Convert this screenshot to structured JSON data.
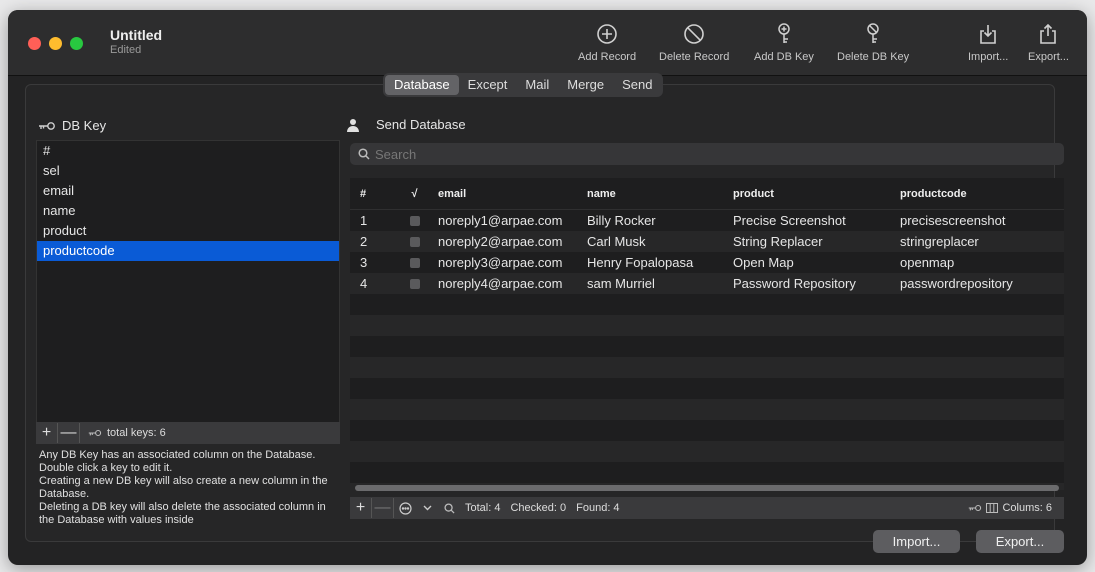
{
  "window": {
    "title": "Untitled",
    "subtitle": "Edited"
  },
  "toolbar": {
    "add_record": "Add Record",
    "delete_record": "Delete Record",
    "add_db_key": "Add DB Key",
    "delete_db_key": "Delete DB Key",
    "import": "Import...",
    "export": "Export..."
  },
  "tabs": [
    "Database",
    "Except",
    "Mail",
    "Merge",
    "Send"
  ],
  "active_tab": "Database",
  "left": {
    "header": "DB Key",
    "keys": [
      "#",
      "sel",
      "email",
      "name",
      "product",
      "productcode"
    ],
    "selected_key": "productcode",
    "footer_add": "+",
    "footer_remove": "—",
    "total_keys": "total keys: 6",
    "help": [
      "Any DB Key has an associated column on the Database. Double click a key to edit it.",
      "Creating a new DB key will also create a new column in the Database.",
      "Deleting a DB key will also delete the associated column in the Database with values inside"
    ]
  },
  "right": {
    "header": "Send Database",
    "search_placeholder": "Search",
    "columns": [
      "#",
      "√",
      "email",
      "name",
      "product",
      "productcode"
    ],
    "rows": [
      {
        "num": "1",
        "email": "noreply1@arpae.com",
        "name": "Billy Rocker",
        "product": "Precise Screenshot",
        "productcode": "precisescreenshot"
      },
      {
        "num": "2",
        "email": "noreply2@arpae.com",
        "name": "Carl Musk",
        "product": "String Replacer",
        "productcode": "stringreplacer"
      },
      {
        "num": "3",
        "email": "noreply3@arpae.com",
        "name": "Henry Fopalopasa",
        "product": "Open Map",
        "productcode": "openmap"
      },
      {
        "num": "4",
        "email": "noreply4@arpae.com",
        "name": "sam Murriel",
        "product": "Password Repository",
        "productcode": "passwordrepository"
      }
    ],
    "footer": {
      "add": "+",
      "remove": "—",
      "total": "Total: 4",
      "checked": "Checked: 0",
      "found": "Found: 4",
      "columns": "Colums: 6"
    },
    "import_button": "Import...",
    "export_button": "Export..."
  },
  "colors": {
    "selection": "#0a5bd6",
    "window_bg": "#232324",
    "red": "#ff5f57",
    "yellow": "#febc2e",
    "green": "#28c840"
  },
  "icons": [
    "plus-circle-icon",
    "no-entry-icon",
    "key-add-icon",
    "key-delete-icon",
    "import-icon",
    "export-icon",
    "key-icon",
    "person-icon",
    "search-icon",
    "more-icon",
    "chevron-down-icon",
    "columns-icon"
  ]
}
